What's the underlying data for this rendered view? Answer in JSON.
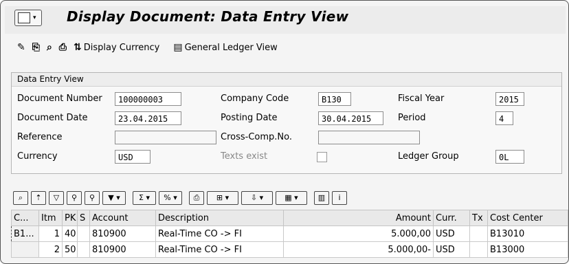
{
  "window": {
    "title": "Display Document: Data Entry View"
  },
  "toolbar": {
    "display_currency": "Display Currency",
    "general_ledger_view": "General Ledger View"
  },
  "group": {
    "title": "Data Entry View"
  },
  "form": {
    "document_number_label": "Document Number",
    "document_number": "100000003",
    "company_code_label": "Company Code",
    "company_code": "B130",
    "fiscal_year_label": "Fiscal Year",
    "fiscal_year": "2015",
    "document_date_label": "Document Date",
    "document_date": "23.04.2015",
    "posting_date_label": "Posting Date",
    "posting_date": "30.04.2015",
    "period_label": "Period",
    "period": "4",
    "reference_label": "Reference",
    "reference": "",
    "cross_comp_label": "Cross-Comp.No.",
    "cross_comp": "",
    "currency_label": "Currency",
    "currency": "USD",
    "texts_exist_label": "Texts exist",
    "ledger_group_label": "Ledger Group",
    "ledger_group": "0L"
  },
  "grid": {
    "headers": [
      "C...",
      "Itm",
      "PK",
      "S",
      "Account",
      "Description",
      "Amount",
      "Curr.",
      "Tx",
      "Cost Center"
    ],
    "rows": [
      [
        "B1...",
        "1",
        "40",
        "",
        "810900",
        "Real-Time CO -> FI",
        "5.000,00",
        "USD",
        "",
        "B13010"
      ],
      [
        "",
        "2",
        "50",
        "",
        "810900",
        "Real-Time CO -> FI",
        "5.000,00-",
        "USD",
        "",
        "B13000"
      ]
    ]
  }
}
